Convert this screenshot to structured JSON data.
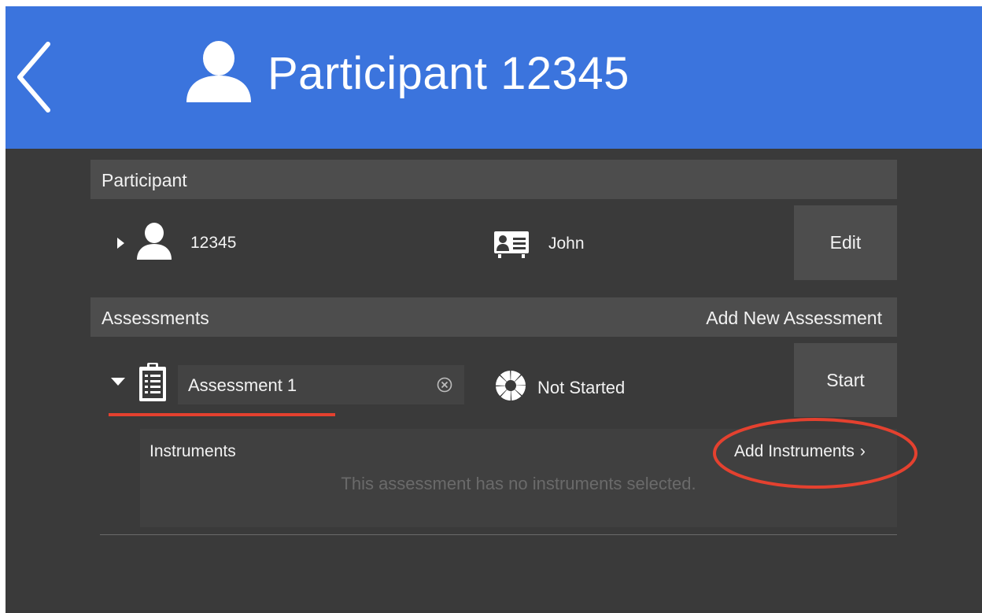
{
  "header": {
    "title": "Participant  12345",
    "back_icon": "chevron-left-icon",
    "user_icon": "user-icon",
    "background_color": "#3b74dd"
  },
  "participant_section": {
    "title": "Participant",
    "participant_id": "12345",
    "name": "John",
    "edit_label": "Edit",
    "expand_icon": "triangle-right-icon",
    "id_card_icon": "id-card-icon"
  },
  "assessments_section": {
    "title": "Assessments",
    "add_label": "Add New Assessment",
    "assessment": {
      "name": "Assessment 1",
      "status": "Not Started",
      "start_label": "Start",
      "expand_icon": "triangle-down-icon",
      "clipboard_icon": "clipboard-icon",
      "clear_icon": "clear-icon",
      "status_icon": "progress-ring-icon"
    },
    "instruments": {
      "title": "Instruments",
      "add_label": "Add Instruments",
      "add_chevron": "›",
      "empty_message": "This assessment has no instruments selected."
    }
  },
  "annotations": {
    "highlight_color": "#e4412f"
  }
}
